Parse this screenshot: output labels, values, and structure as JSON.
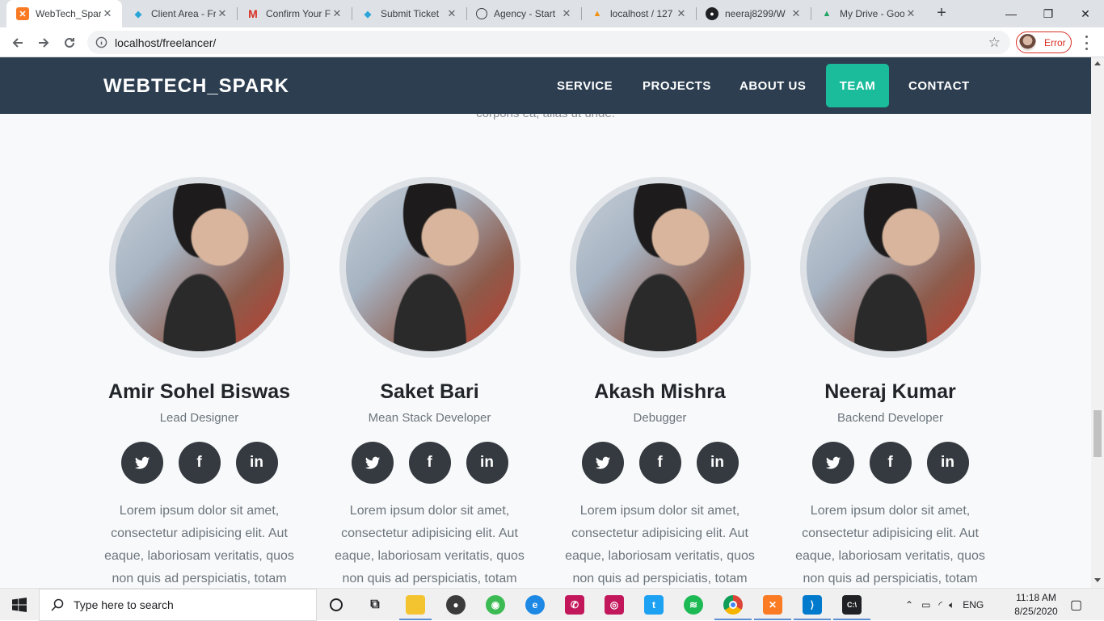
{
  "browser": {
    "tabs": [
      {
        "title": "WebTech_Spar",
        "active": true,
        "icon": "xampp-icon"
      },
      {
        "title": "Client Area - Fr",
        "active": false,
        "icon": "client-icon"
      },
      {
        "title": "Confirm Your F",
        "active": false,
        "icon": "gmail-icon"
      },
      {
        "title": "Submit Ticket",
        "active": false,
        "icon": "ticket-icon"
      },
      {
        "title": "Agency - Start",
        "active": false,
        "icon": "globe-icon"
      },
      {
        "title": "localhost / 127",
        "active": false,
        "icon": "phpmyadmin-icon"
      },
      {
        "title": "neeraj8299/W",
        "active": false,
        "icon": "github-icon"
      },
      {
        "title": "My Drive - Goo",
        "active": false,
        "icon": "drive-icon"
      }
    ],
    "url": "localhost/freelancer/",
    "profile_status": "Error"
  },
  "site": {
    "brand": "WEBTECH_SPARK",
    "nav": [
      {
        "label": "SERVICE",
        "active": false
      },
      {
        "label": "PROJECTS",
        "active": false
      },
      {
        "label": "ABOUT US",
        "active": false
      },
      {
        "label": "TEAM",
        "active": true
      },
      {
        "label": "CONTACT",
        "active": false
      }
    ],
    "partial_text": "corporis ea, alias ut unde.",
    "team": [
      {
        "name": "Amir Sohel Biswas",
        "role": "Lead Designer"
      },
      {
        "name": "Saket Bari",
        "role": "Mean Stack Developer"
      },
      {
        "name": "Akash Mishra",
        "role": "Debugger"
      },
      {
        "name": "Neeraj Kumar",
        "role": "Backend Developer"
      }
    ],
    "bio": "Lorem ipsum dolor sit amet, consectetur adipisicing elit. Aut eaque, laboriosam veritatis, quos non quis ad perspiciatis, totam corporis ea, alias ut unde.",
    "socials": [
      "twitter-icon",
      "facebook-icon",
      "linkedin-icon"
    ]
  },
  "taskbar": {
    "search_placeholder": "Type here to search",
    "language": "ENG",
    "time": "11:18 AM",
    "date": "8/25/2020"
  },
  "colors": {
    "navbar": "#2c3e50",
    "accent": "#1abc9c",
    "social_bg": "#343a40"
  }
}
